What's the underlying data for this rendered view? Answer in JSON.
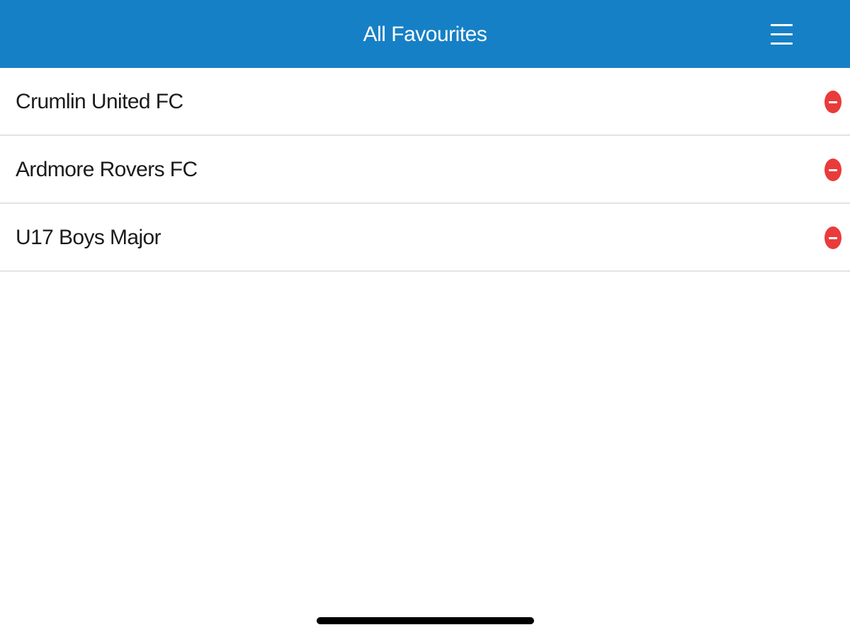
{
  "header": {
    "title": "All Favourites",
    "menu_icon": "hamburger-menu-icon",
    "background_color": "#1680c6"
  },
  "favourites": [
    {
      "label": "Crumlin United FC",
      "action_icon": "remove-circle-icon"
    },
    {
      "label": "Ardmore Rovers FC",
      "action_icon": "remove-circle-icon"
    },
    {
      "label": "U17 Boys Major",
      "action_icon": "remove-circle-icon"
    }
  ],
  "colors": {
    "remove": "#ea3b3b",
    "divider": "#e3e3e3"
  }
}
